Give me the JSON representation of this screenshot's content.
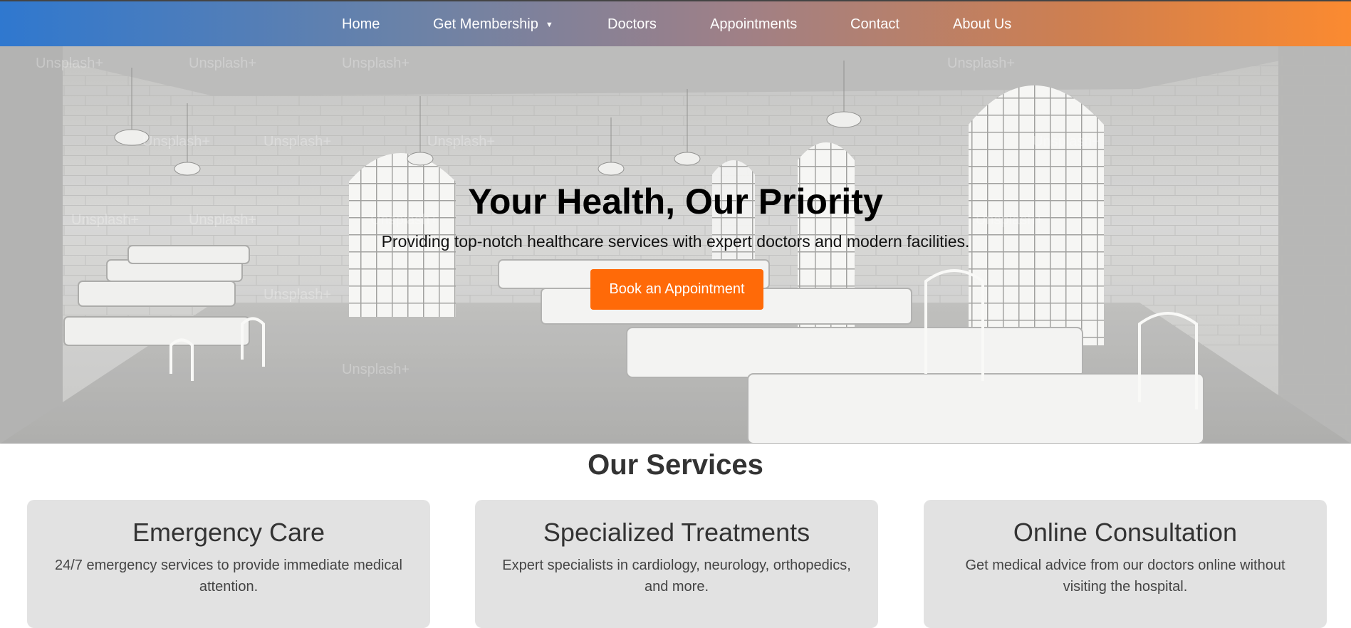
{
  "nav": {
    "items": [
      "Home",
      "Get Membership",
      "Doctors",
      "Appointments",
      "Contact",
      "About Us"
    ],
    "dropdown_icon": "triangle-down-icon"
  },
  "hero": {
    "title": "Your Health, Our Priority",
    "subtitle": "Providing top-notch healthcare services with expert doctors and modern facilities.",
    "cta_label": "Book an Appointment",
    "watermark": "Unsplash+"
  },
  "services": {
    "title": "Our Services",
    "cards": [
      {
        "title": "Emergency Care",
        "text": "24/7 emergency services to provide immediate medical attention."
      },
      {
        "title": "Specialized Treatments",
        "text": "Expert specialists in cardiology, neurology, orthopedics, and more."
      },
      {
        "title": "Online Consultation",
        "text": "Get medical advice from our doctors online without visiting the hospital."
      }
    ]
  },
  "colors": {
    "nav_start": "#2f78cf",
    "nav_end": "#fb8a30",
    "accent": "#ff6a08",
    "card_bg": "#e2e2e2"
  }
}
